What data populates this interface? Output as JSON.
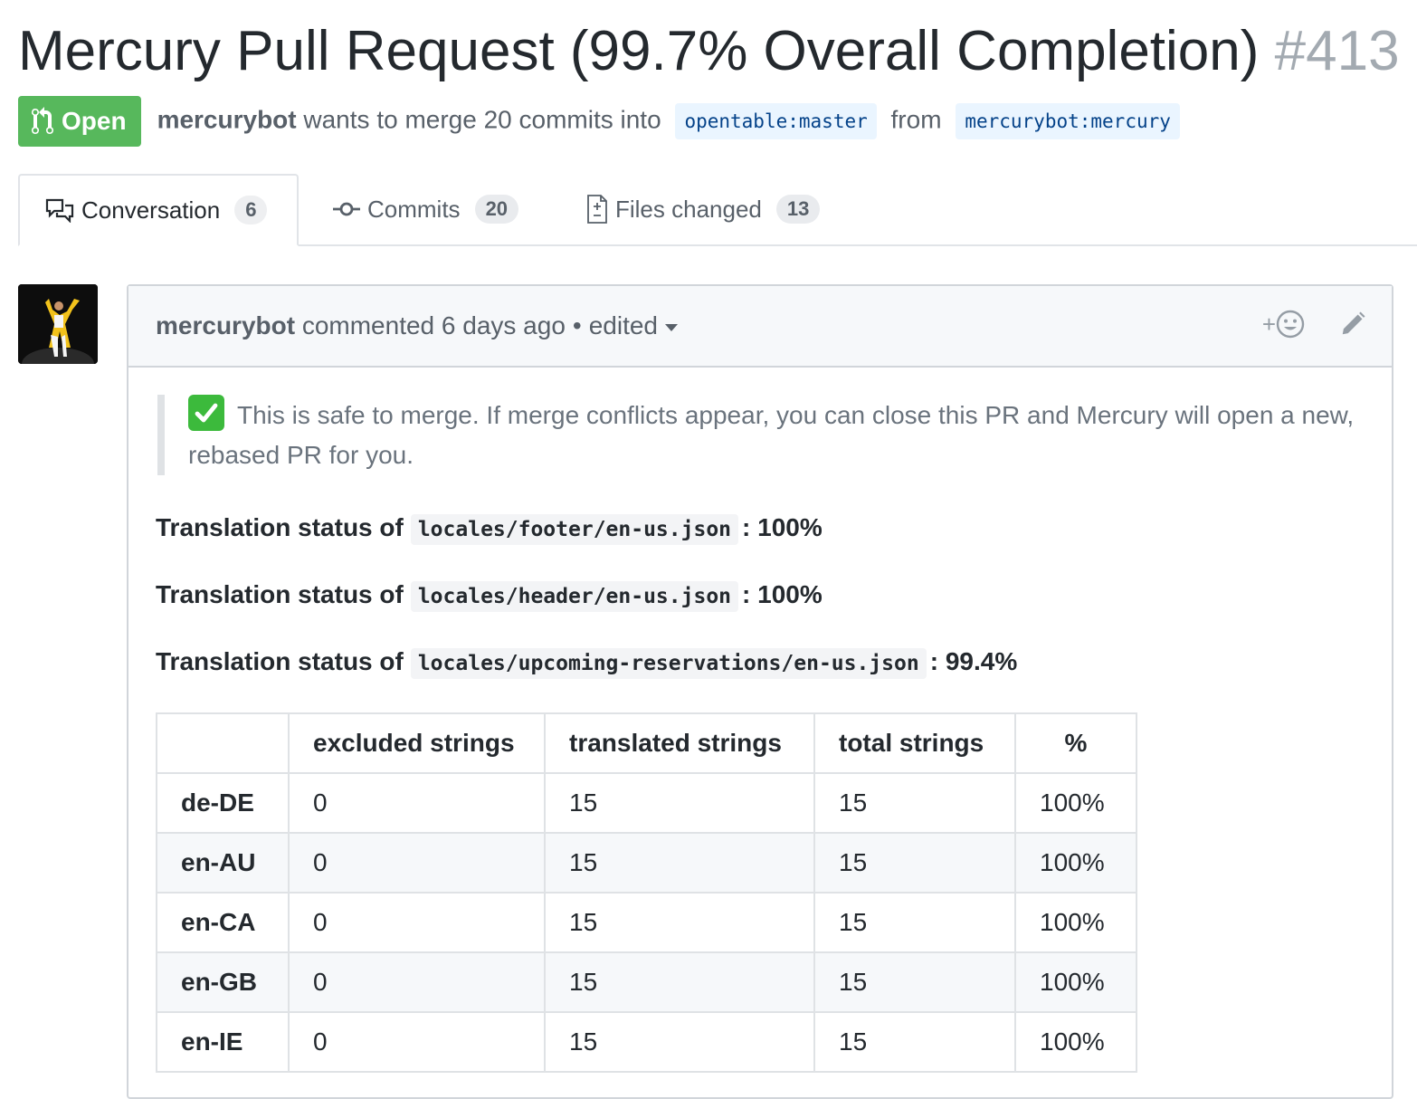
{
  "pr": {
    "title": "Mercury Pull Request (99.7% Overall Completion)",
    "number": "#413",
    "state": "Open",
    "author": "mercurybot",
    "merge_text": "wants to merge 20 commits into",
    "base_branch": "opentable:master",
    "from_text": "from",
    "head_branch": "mercurybot:mercury"
  },
  "tabs": [
    {
      "label": "Conversation",
      "count": "6",
      "icon": "comment-discussion-icon"
    },
    {
      "label": "Commits",
      "count": "20",
      "icon": "git-commit-icon"
    },
    {
      "label": "Files changed",
      "count": "13",
      "icon": "diff-icon"
    }
  ],
  "comment": {
    "author": "mercurybot",
    "action": "commented 6 days ago",
    "edited": "edited",
    "notice": "This is safe to merge. If merge conflicts appear, you can close this PR and Mercury will open a new, rebased PR for you.",
    "status_prefix": "Translation status of",
    "statuses": [
      {
        "file": "locales/footer/en-us.json",
        "value": ": 100%"
      },
      {
        "file": "locales/header/en-us.json",
        "value": ": 100%"
      },
      {
        "file": "locales/upcoming-reservations/en-us.json",
        "value": ": 99.4%"
      }
    ],
    "table": {
      "headers": [
        "",
        "excluded strings",
        "translated strings",
        "total strings",
        "%"
      ],
      "rows": [
        [
          "de-DE",
          "0",
          "15",
          "15",
          "100%"
        ],
        [
          "en-AU",
          "0",
          "15",
          "15",
          "100%"
        ],
        [
          "en-CA",
          "0",
          "15",
          "15",
          "100%"
        ],
        [
          "en-GB",
          "0",
          "15",
          "15",
          "100%"
        ],
        [
          "en-IE",
          "0",
          "15",
          "15",
          "100%"
        ]
      ]
    }
  },
  "colors": {
    "open_green": "#57b85c",
    "link_blue": "#044289",
    "branch_bg": "#eaf5ff",
    "check_green": "#3cba3c"
  }
}
